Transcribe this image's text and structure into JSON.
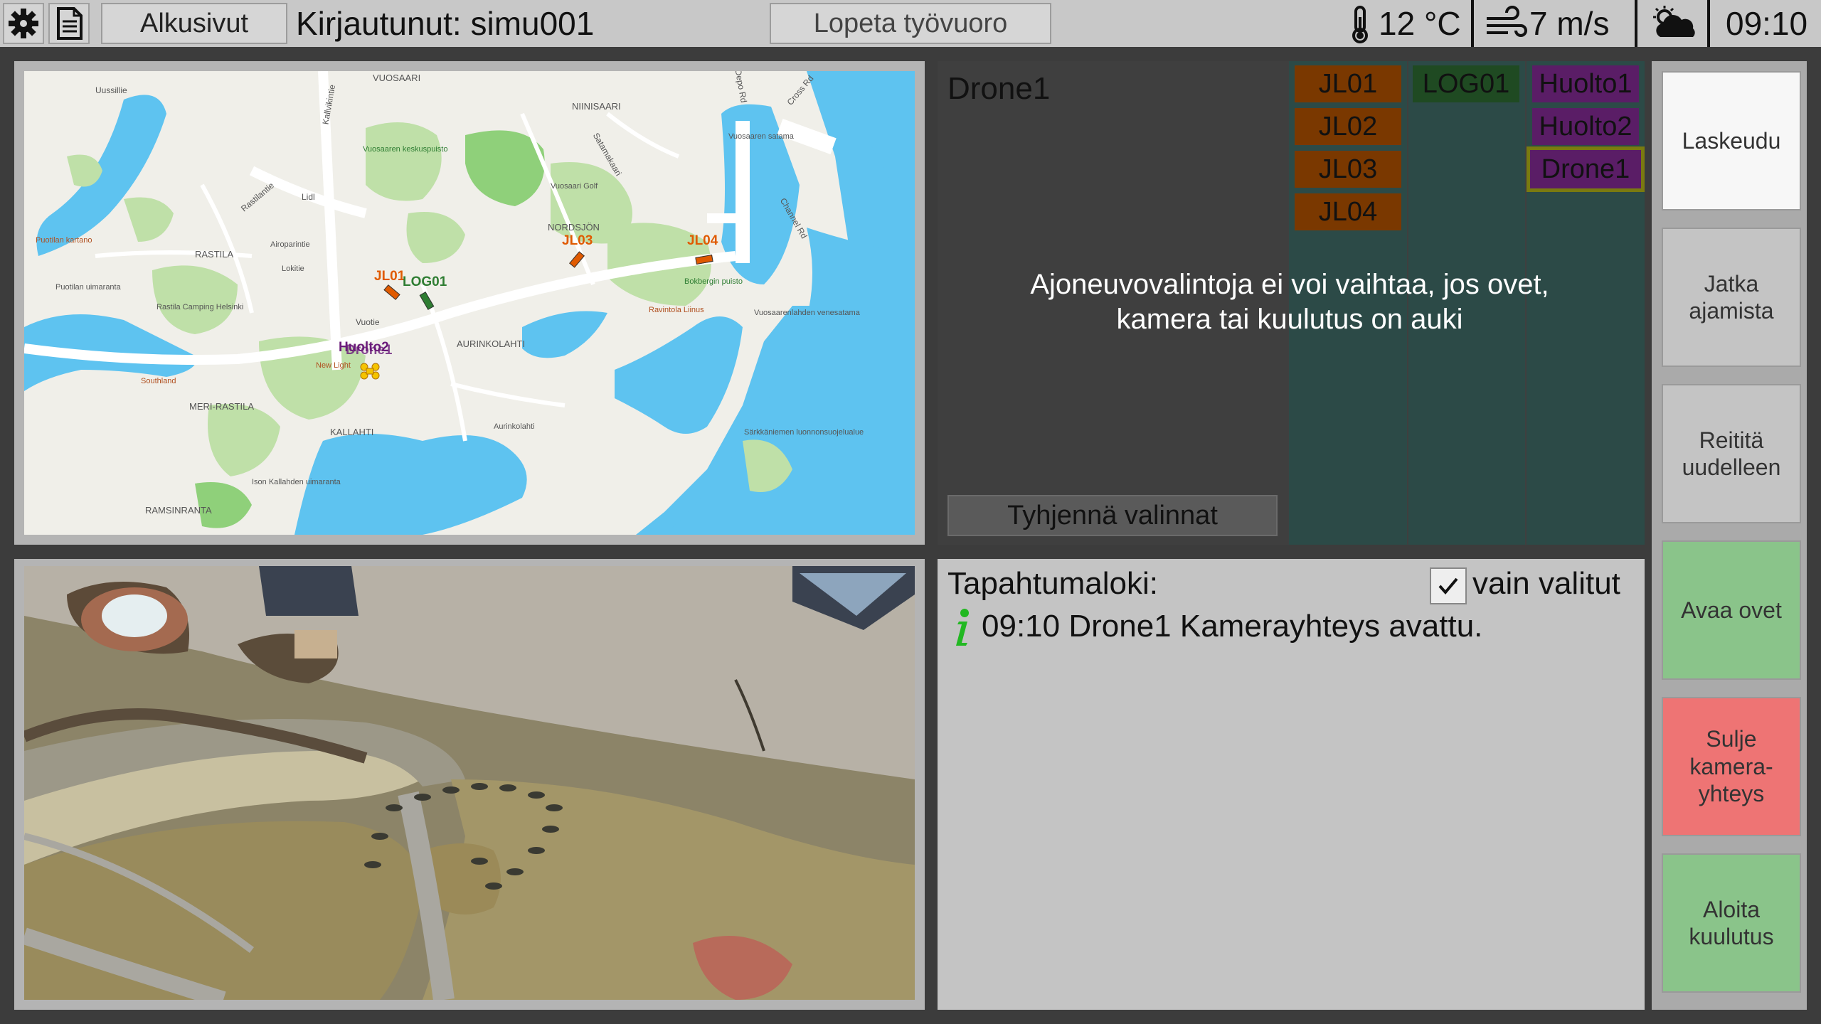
{
  "topbar": {
    "settings_icon": "gear-icon",
    "pages_icon": "document-icon",
    "home_button": "Alkusivut",
    "logged_in": "Kirjautunut: simu001",
    "end_shift_button": "Lopeta työvuoro",
    "temperature": "12 °C",
    "wind": "7 m/s",
    "weather_icon": "cloud-sun-icon",
    "time": "09:10"
  },
  "map": {
    "labels": [
      "VUOSAARI",
      "NIINISAARI",
      "Uussillie",
      "Vuosaaren keskuspuisto",
      "Vuosaari Golf",
      "NORDSJÖN",
      "Vuosaaren satama",
      "Rastilantie",
      "Lidl",
      "Puotilan kartano",
      "RASTILA",
      "Airoparintie",
      "Lokitie",
      "Rastila Camping Helsinki",
      "Puotilan uimaranta",
      "Vuotie",
      "Bokbergin puisto",
      "Ravintola Liinus",
      "Vuosaarenlahden venesatama",
      "AURINKOLAHTI",
      "New Light",
      "Southland",
      "MERI-RASTILA",
      "KALLAHTI",
      "Aurinkolahti",
      "Särkkäniemen luonnonsuojelualue",
      "Ison Kallahden uimaranta",
      "RAMSINRANTA",
      "Kallvikintie",
      "Satamakaari",
      "Cross Rd",
      "Depo Rd",
      "Channel Rd"
    ],
    "vehicles": [
      {
        "name": "JL01",
        "color": "#e05a00"
      },
      {
        "name": "LOG01",
        "color": "#2e7d32"
      },
      {
        "name": "JL03",
        "color": "#e05a00"
      },
      {
        "name": "JL04",
        "color": "#e05a00"
      },
      {
        "name": "Huolto2",
        "color": "#6a1b7a"
      },
      {
        "name": "Drone1",
        "color": "#6a1b7a"
      }
    ]
  },
  "vehicle_panel": {
    "selected_title": "Drone1",
    "notice": "Ajoneuvovalintoja ei voi vaihtaa, jos ovet, kamera tai kuulutus on auki",
    "clear_button": "Tyhjennä valinnat",
    "column_jl": [
      "JL01",
      "JL02",
      "JL03",
      "JL04"
    ],
    "column_log": [
      "LOG01"
    ],
    "column_maint": [
      "Huolto1",
      "Huolto2",
      "Drone1"
    ]
  },
  "log": {
    "title": "Tapahtumaloki:",
    "only_selected_label": "vain valitut",
    "only_selected_checked": true,
    "entries": [
      {
        "icon": "info-icon",
        "text": "09:10 Drone1 Kamerayhteys avattu."
      }
    ]
  },
  "side": {
    "land": "Laskeudu",
    "continue": "Jatka\najamista",
    "reroute": "Reititä\nuudelleen",
    "open_doors": "Avaa ovet",
    "close_camera": "Sulje\nkamera-\nyhteys",
    "start_announcement": "Aloita\nkuulutus"
  }
}
